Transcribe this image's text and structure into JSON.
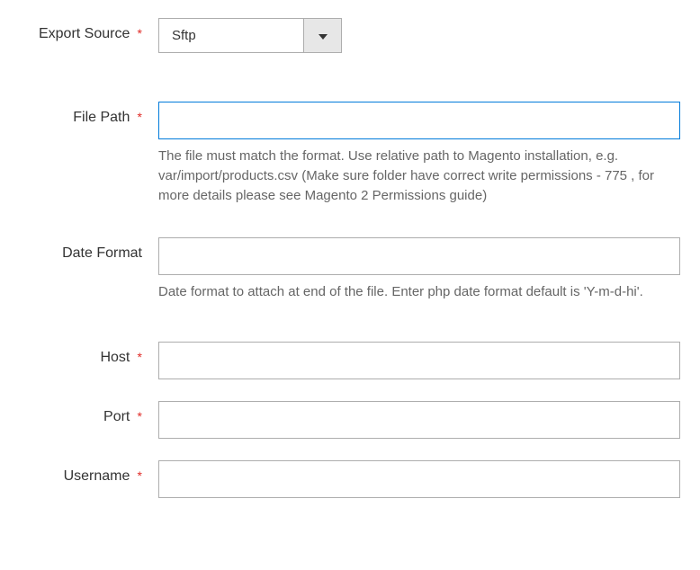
{
  "fields": {
    "export_source": {
      "label": "Export Source",
      "required_mark": "*",
      "value": "Sftp"
    },
    "file_path": {
      "label": "File Path",
      "required_mark": "*",
      "value": "",
      "helper": "The file must match the format. Use relative path to Magento installation, e.g. var/import/products.csv (Make sure folder have correct write permissions - 775 , for more details please see Magento 2 Permissions guide)"
    },
    "date_format": {
      "label": "Date Format",
      "value": "",
      "helper": "Date format to attach at end of the file. Enter php date format default is 'Y-m-d-hi'."
    },
    "host": {
      "label": "Host",
      "required_mark": "*",
      "value": ""
    },
    "port": {
      "label": "Port",
      "required_mark": "*",
      "value": ""
    },
    "username": {
      "label": "Username",
      "required_mark": "*",
      "value": ""
    }
  }
}
